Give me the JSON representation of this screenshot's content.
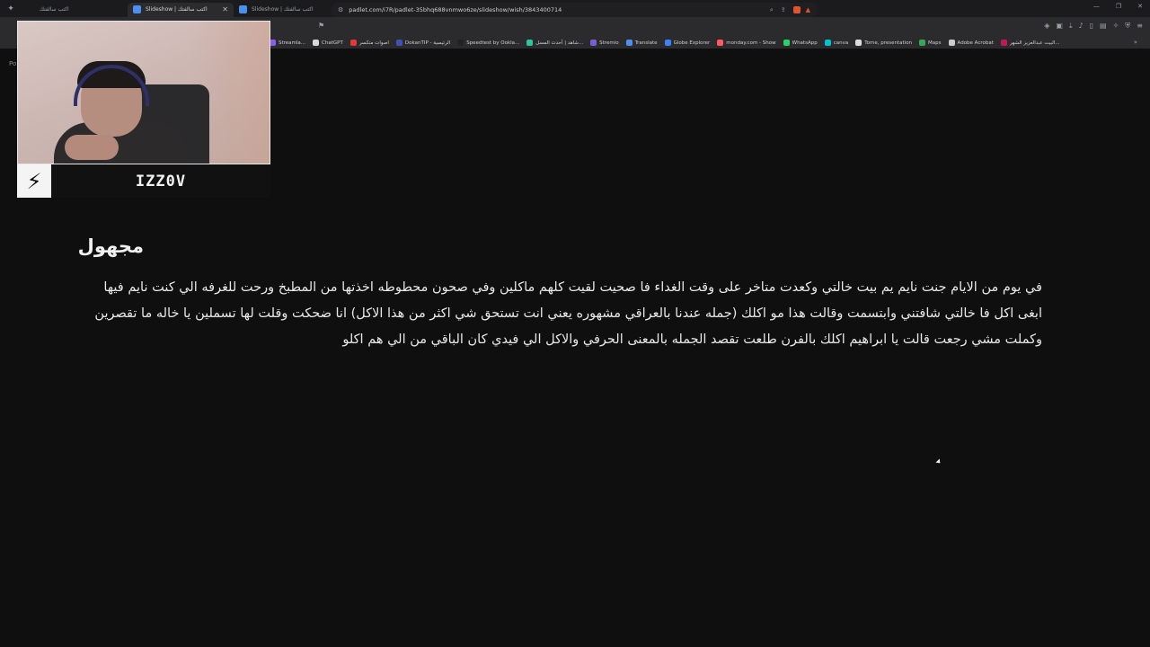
{
  "browser": {
    "tabs": [
      {
        "title": "اكتب سالفتك",
        "active": false
      },
      {
        "title": "Slideshow | اكتب سالفتك",
        "active": true
      },
      {
        "title": "Slideshow | اكتب سالفتك",
        "active": false
      }
    ],
    "url": "padlet.com/i7R/padlet-35bhq688vnmwo6ze/slideshow/wish/3843400714",
    "bookmarks": [
      {
        "label": "Streamla...",
        "color": "#8a5cf6"
      },
      {
        "label": "ChatGPT",
        "color": "#d9d9d9"
      },
      {
        "label": "اصوات متكسر",
        "color": "#e53935"
      },
      {
        "label": "DokanTIP - الرئيسية",
        "color": "#3f51b5"
      },
      {
        "label": "Speedtest by Ookla...",
        "color": "#222222"
      },
      {
        "label": "شاهد | أحدث المسل...",
        "color": "#2ec4a0"
      },
      {
        "label": "Stremio",
        "color": "#7b5cd6"
      },
      {
        "label": "Translate",
        "color": "#4b8ff0"
      },
      {
        "label": "Globe Explorer",
        "color": "#3b82f6"
      },
      {
        "label": "monday.com - Show",
        "color": "#ff5a5f"
      },
      {
        "label": "WhatsApp",
        "color": "#25d366"
      },
      {
        "label": "canva",
        "color": "#00c4cc"
      },
      {
        "label": "Tome, presentation",
        "color": "#dddddd"
      },
      {
        "label": "Maps",
        "color": "#34a853"
      },
      {
        "label": "Adobe Acrobat",
        "color": "#cccccc"
      },
      {
        "label": "البيت عبدالعزيز الشهر...",
        "color": "#c2185b"
      }
    ]
  },
  "page": {
    "stub": "Po",
    "post_title": "مجهول",
    "post_lines": [
      "في يوم من الايام جنت نايم يم بيت خالتي وكعدت متاخر على وقت الغداء فا صحيت لقيت كلهم ماكلين وفي صحون محطوطه اخذتها من المطبخ ورحت للغرفه الي كنت نايم فيها",
      "ابغى اكل فا خالتي شافتني وابتسمت وقالت هذا مو اكلك (جمله عندنا بالعراقي مشهوره يعني انت تستحق شي اكثر من هذا الاكل) انا ضحكت وقلت لها تسملين يا خاله ما تقصرين",
      "وكملت مشي رجعت قالت يا ابراهيم اكلك بالفرن طلعت تقصد الجمله بالمعنى الحرفي والاكل الي فيدي كان الباقي من الي هم اكلو"
    ]
  },
  "webcam": {
    "streamer_name": "IZZ0V"
  }
}
